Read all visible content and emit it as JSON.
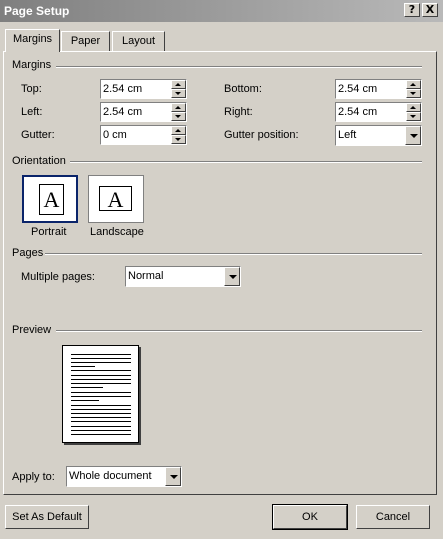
{
  "window": {
    "title": "Page Setup",
    "help_button": "?",
    "close_button": "X"
  },
  "tabs": [
    {
      "label": "Margins",
      "active": true
    },
    {
      "label": "Paper",
      "active": false
    },
    {
      "label": "Layout",
      "active": false
    }
  ],
  "margins": {
    "section_label": "Margins",
    "top": {
      "label": "Top:",
      "value": "2.54 cm"
    },
    "bottom": {
      "label": "Bottom:",
      "value": "2.54 cm"
    },
    "left": {
      "label": "Left:",
      "value": "2.54 cm"
    },
    "right": {
      "label": "Right:",
      "value": "2.54 cm"
    },
    "gutter": {
      "label": "Gutter:",
      "value": "0 cm"
    },
    "gutter_position": {
      "label": "Gutter position:",
      "value": "Left"
    }
  },
  "orientation": {
    "section_label": "Orientation",
    "portrait_label": "Portrait",
    "landscape_label": "Landscape",
    "glyph": "A",
    "selected": "Portrait"
  },
  "pages": {
    "section_label": "Pages",
    "multiple_pages_label": "Multiple pages:",
    "multiple_pages_value": "Normal"
  },
  "preview": {
    "section_label": "Preview",
    "apply_to_label": "Apply to:",
    "apply_to_value": "Whole document"
  },
  "buttons": {
    "set_default": "Set As Default",
    "ok": "OK",
    "cancel": "Cancel"
  },
  "colors": {
    "face": "#d4d0c8",
    "title_left": "#7f7f7f",
    "title_right": "#b9b9b9",
    "selection": "#0a246a"
  }
}
